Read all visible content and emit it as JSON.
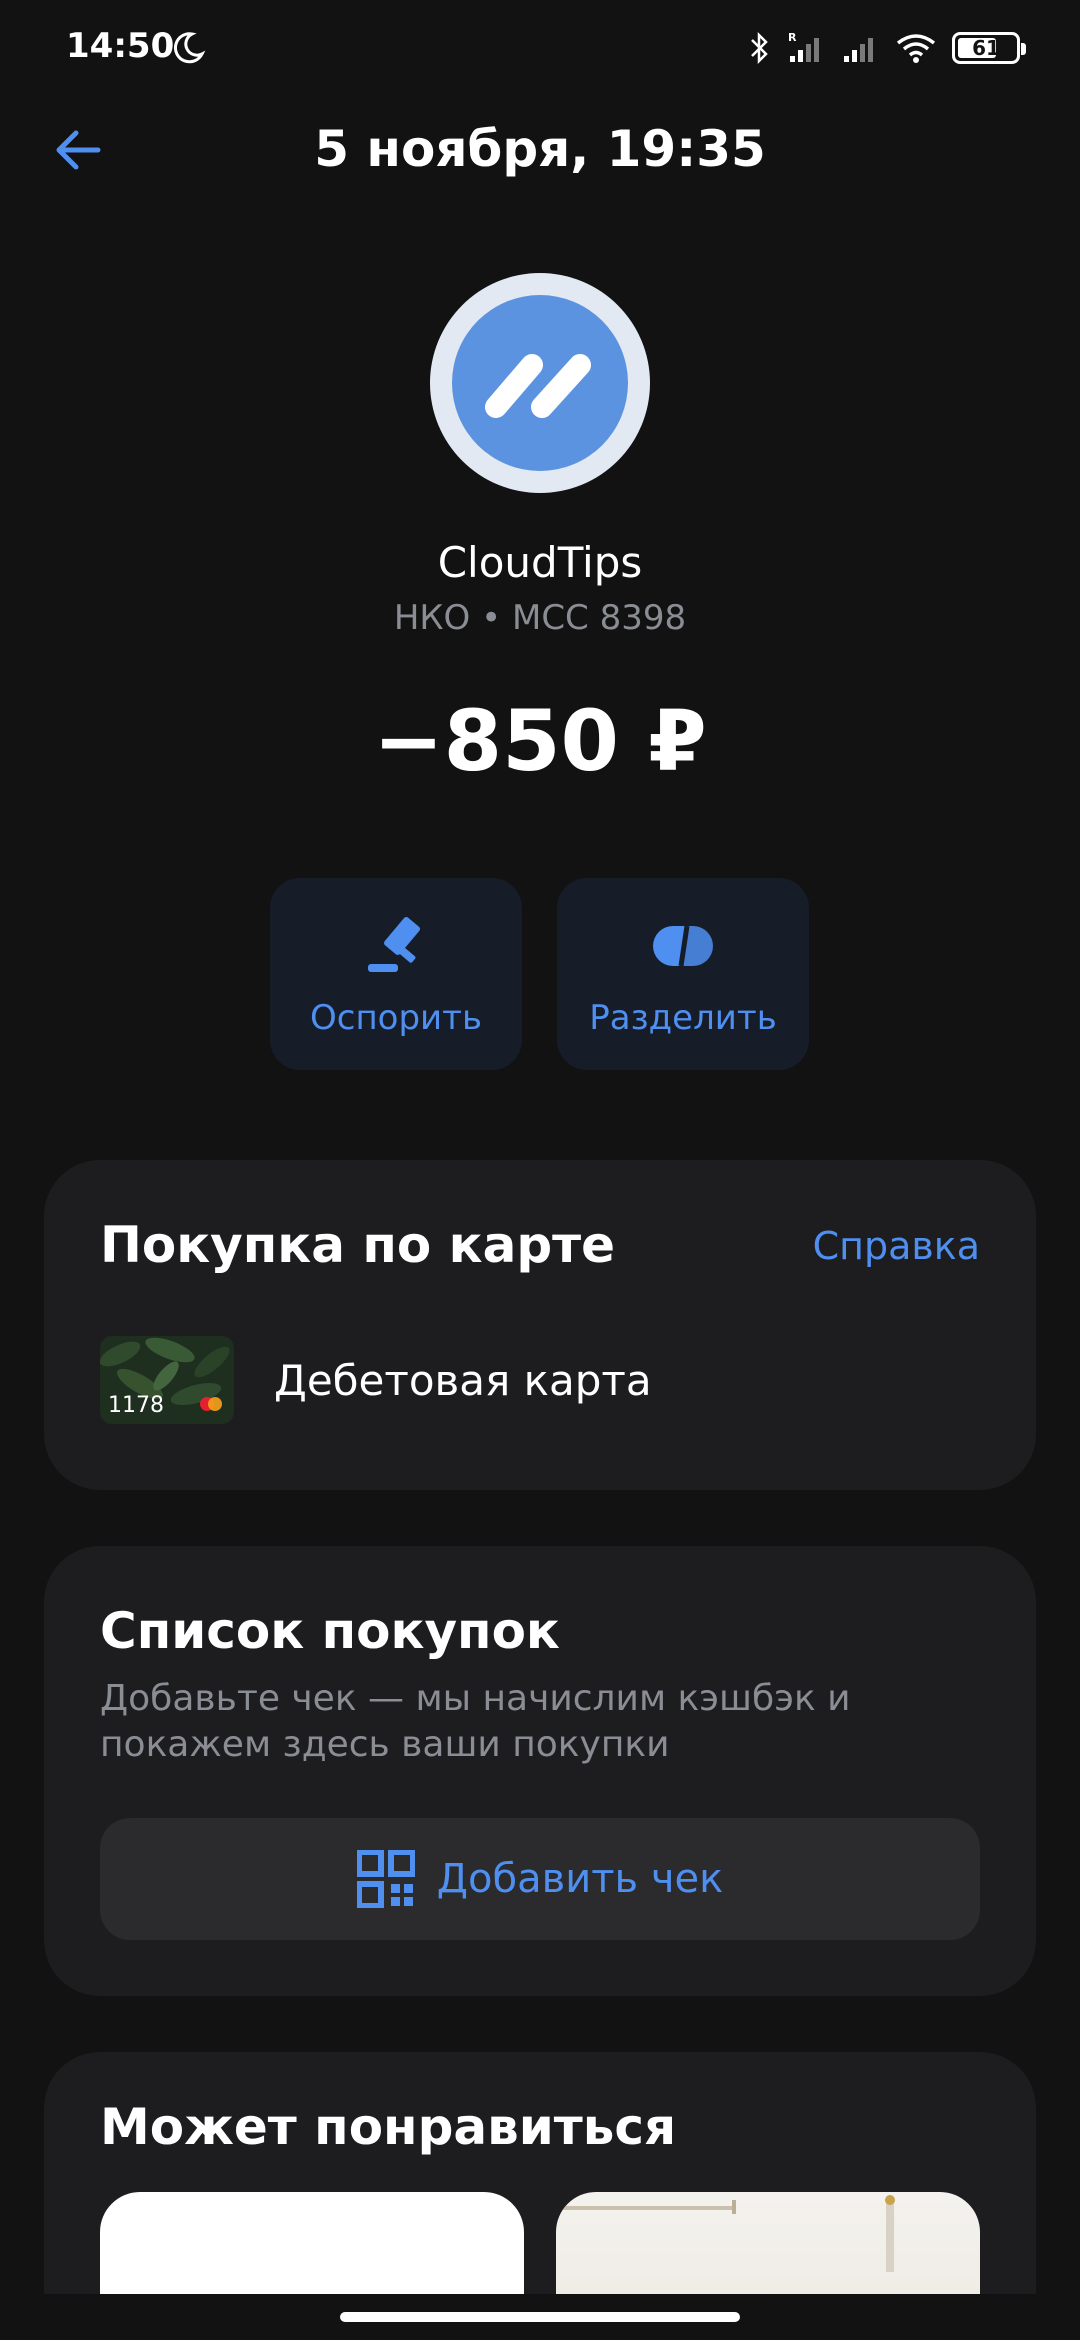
{
  "status_bar": {
    "time": "14:50",
    "battery": "61"
  },
  "header": {
    "title": "5 ноября, 19:35"
  },
  "merchant": {
    "name": "CloudTips",
    "meta": "НКО • MCC 8398",
    "amount": "−850 ₽"
  },
  "actions": {
    "dispute_label": "Оспорить",
    "split_label": "Разделить"
  },
  "purchase_card": {
    "title": "Покупка по карте",
    "help_label": "Справка",
    "card_number": "1178",
    "card_name": "Дебетовая карта"
  },
  "purchase_list": {
    "title": "Список покупок",
    "description": "Добавьте чек — мы начислим кэшбэк и покажем здесь ваши покупки",
    "button_label": "Добавить чек"
  },
  "recommend": {
    "title": "Может понравиться"
  },
  "colors": {
    "background": "#121212",
    "card": "#1d1d1f",
    "accent": "#4e8ff0",
    "action_bg": "#161d29",
    "secondary_text": "#8a8d93"
  },
  "icons": [
    "moon-icon",
    "bluetooth-icon",
    "signal-icon",
    "wifi-icon",
    "battery-icon",
    "back-arrow-icon",
    "cloudtips-logo",
    "gavel-icon",
    "split-icon",
    "qr-code-icon",
    "mastercard-icon"
  ]
}
